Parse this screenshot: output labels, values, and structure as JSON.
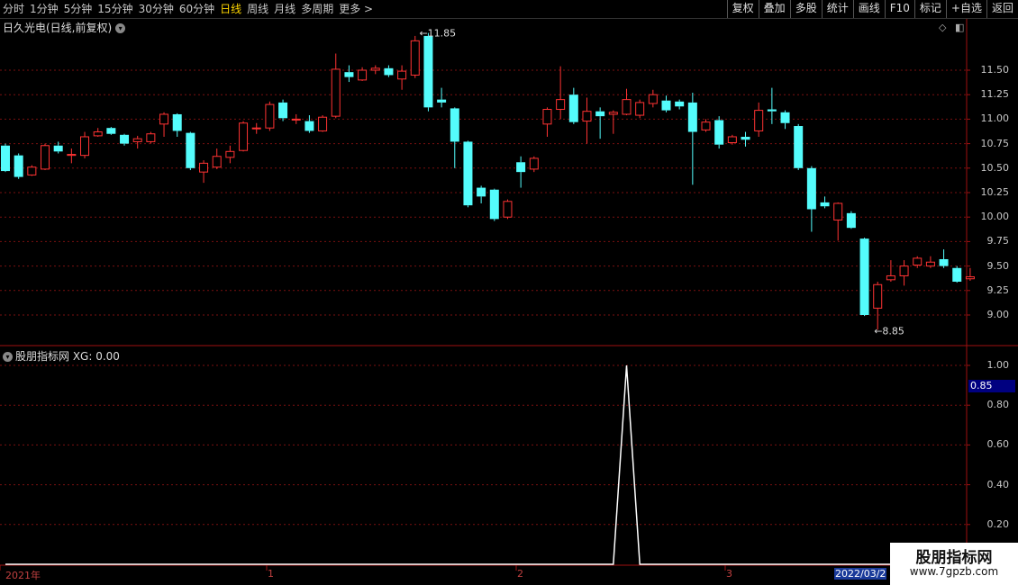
{
  "toolbar": {
    "periods": [
      "分时",
      "1分钟",
      "5分钟",
      "15分钟",
      "30分钟",
      "60分钟",
      "日线",
      "周线",
      "月线",
      "多周期",
      "更多"
    ],
    "active_period": "日线",
    "more_arrow": ">",
    "actions": [
      "复权",
      "叠加",
      "多股",
      "统计",
      "画线",
      "F10",
      "标记",
      "+自选",
      "返回"
    ]
  },
  "stock": {
    "title": "日久光电(日线,前复权)"
  },
  "indicator": {
    "title": "股朋指标网 XG: 0.00"
  },
  "price_axis": [
    "11.50",
    "11.25",
    "11.00",
    "10.75",
    "10.50",
    "10.25",
    "10.00",
    "9.75",
    "9.50",
    "9.25",
    "9.00"
  ],
  "indicator_axis": [
    "1.00",
    "0.80",
    "0.60",
    "0.40",
    "0.20"
  ],
  "cursor_value": "0.85",
  "annotations": {
    "high": "11.85",
    "low": "8.85"
  },
  "time_axis": [
    "2021年",
    "1",
    "2",
    "3"
  ],
  "current_date": "2022/03/2",
  "watermark": {
    "title": "股朋指标网",
    "url": "www.7gpzb.com"
  },
  "colors": {
    "up": "#ff3333",
    "down": "#54fcfc",
    "grid": "#7a1010",
    "border": "#a01010",
    "line": "#ffffff"
  },
  "chart_data": {
    "type": "candlestick",
    "ylim": [
      8.75,
      11.95
    ],
    "candles": [
      [
        10.73,
        10.47,
        10.75,
        10.46
      ],
      [
        10.63,
        10.41,
        10.65,
        10.39
      ],
      [
        10.43,
        10.51,
        10.53,
        10.42
      ],
      [
        10.49,
        10.73,
        10.75,
        10.48
      ],
      [
        10.73,
        10.67,
        10.77,
        10.65
      ],
      [
        10.63,
        10.64,
        10.7,
        10.55
      ],
      [
        10.63,
        10.82,
        10.87,
        10.6
      ],
      [
        10.83,
        10.87,
        10.91,
        10.82
      ],
      [
        10.91,
        10.85,
        10.92,
        10.84
      ],
      [
        10.84,
        10.75,
        10.85,
        10.73
      ],
      [
        10.77,
        10.8,
        10.83,
        10.7
      ],
      [
        10.77,
        10.85,
        10.87,
        10.75
      ],
      [
        10.95,
        11.05,
        11.07,
        10.82
      ],
      [
        11.05,
        10.88,
        11.06,
        10.82
      ],
      [
        10.86,
        10.5,
        10.87,
        10.48
      ],
      [
        10.46,
        10.55,
        10.58,
        10.35
      ],
      [
        10.51,
        10.62,
        10.7,
        10.49
      ],
      [
        10.61,
        10.67,
        10.73,
        10.55
      ],
      [
        10.68,
        10.96,
        10.98,
        10.67
      ],
      [
        10.91,
        10.91,
        10.96,
        10.85
      ],
      [
        10.91,
        11.15,
        11.18,
        10.88
      ],
      [
        11.17,
        11.01,
        11.2,
        10.98
      ],
      [
        11.0,
        11.0,
        11.05,
        10.95
      ],
      [
        10.98,
        10.88,
        11.04,
        10.86
      ],
      [
        10.88,
        11.02,
        11.04,
        10.87
      ],
      [
        11.03,
        11.51,
        11.67,
        11.01
      ],
      [
        11.48,
        11.43,
        11.55,
        11.38
      ],
      [
        11.4,
        11.5,
        11.53,
        11.39
      ],
      [
        11.5,
        11.52,
        11.55,
        11.46
      ],
      [
        11.52,
        11.45,
        11.55,
        11.43
      ],
      [
        11.41,
        11.49,
        11.55,
        11.3
      ],
      [
        11.45,
        11.8,
        11.85,
        11.42
      ],
      [
        11.85,
        11.12,
        11.88,
        11.08
      ],
      [
        11.2,
        11.17,
        11.32,
        11.12
      ],
      [
        11.11,
        10.77,
        11.12,
        10.5
      ],
      [
        10.77,
        10.12,
        10.78,
        10.1
      ],
      [
        10.3,
        10.21,
        10.32,
        10.14
      ],
      [
        10.28,
        9.98,
        10.29,
        9.96
      ],
      [
        10.0,
        10.16,
        10.18,
        9.98
      ],
      [
        10.56,
        10.46,
        10.62,
        10.3
      ],
      [
        10.49,
        10.6,
        10.62,
        10.46
      ],
      [
        10.95,
        11.1,
        11.12,
        10.82
      ],
      [
        11.1,
        11.2,
        11.54,
        11.0
      ],
      [
        11.25,
        10.97,
        11.32,
        10.95
      ],
      [
        10.98,
        11.08,
        11.22,
        10.75
      ],
      [
        11.08,
        11.03,
        11.12,
        10.8
      ],
      [
        11.05,
        11.07,
        11.09,
        10.85
      ],
      [
        11.05,
        11.2,
        11.31,
        11.04
      ],
      [
        11.04,
        11.17,
        11.2,
        11.01
      ],
      [
        11.16,
        11.25,
        11.3,
        11.12
      ],
      [
        11.19,
        11.09,
        11.24,
        11.07
      ],
      [
        11.18,
        11.13,
        11.2,
        11.1
      ],
      [
        11.17,
        10.87,
        11.27,
        10.33
      ],
      [
        10.89,
        10.97,
        11.0,
        10.87
      ],
      [
        10.99,
        10.74,
        11.03,
        10.7
      ],
      [
        10.76,
        10.82,
        10.84,
        10.74
      ],
      [
        10.82,
        10.79,
        10.87,
        10.72
      ],
      [
        10.88,
        11.09,
        11.17,
        10.82
      ],
      [
        11.1,
        11.08,
        11.32,
        10.95
      ],
      [
        11.07,
        10.96,
        11.09,
        10.9
      ],
      [
        10.93,
        10.5,
        10.95,
        10.48
      ],
      [
        10.5,
        10.08,
        10.52,
        9.85
      ],
      [
        10.15,
        10.11,
        10.21,
        10.09
      ],
      [
        9.97,
        10.14,
        10.15,
        9.76
      ],
      [
        10.04,
        9.89,
        10.06,
        9.88
      ],
      [
        9.78,
        9.0,
        9.79,
        8.99
      ],
      [
        9.07,
        9.31,
        9.34,
        8.85
      ],
      [
        9.36,
        9.4,
        9.56,
        9.34
      ],
      [
        9.4,
        9.5,
        9.56,
        9.3
      ],
      [
        9.51,
        9.58,
        9.6,
        9.48
      ],
      [
        9.5,
        9.54,
        9.6,
        9.48
      ],
      [
        9.57,
        9.5,
        9.67,
        9.48
      ],
      [
        9.48,
        9.34,
        9.5,
        9.33
      ],
      [
        9.37,
        9.39,
        9.48,
        9.35
      ]
    ],
    "indicator_series": [
      0,
      0,
      0,
      0,
      0,
      0,
      0,
      0,
      0,
      0,
      0,
      0,
      0,
      0,
      0,
      0,
      0,
      0,
      0,
      0,
      0,
      0,
      0,
      0,
      0,
      0,
      0,
      0,
      0,
      0,
      0,
      0,
      0,
      0,
      0,
      0,
      0,
      0,
      0,
      0,
      0,
      0,
      0,
      0,
      0,
      0,
      0,
      0,
      0,
      0,
      0,
      0,
      0,
      0,
      0,
      0,
      0,
      0,
      0,
      0,
      0,
      0,
      0,
      0,
      0,
      0,
      0,
      0,
      0,
      0,
      0,
      0,
      0,
      0
    ],
    "signal_index": 47,
    "signal_value": 1.0,
    "indicator_ylim": [
      0,
      1.0
    ]
  }
}
